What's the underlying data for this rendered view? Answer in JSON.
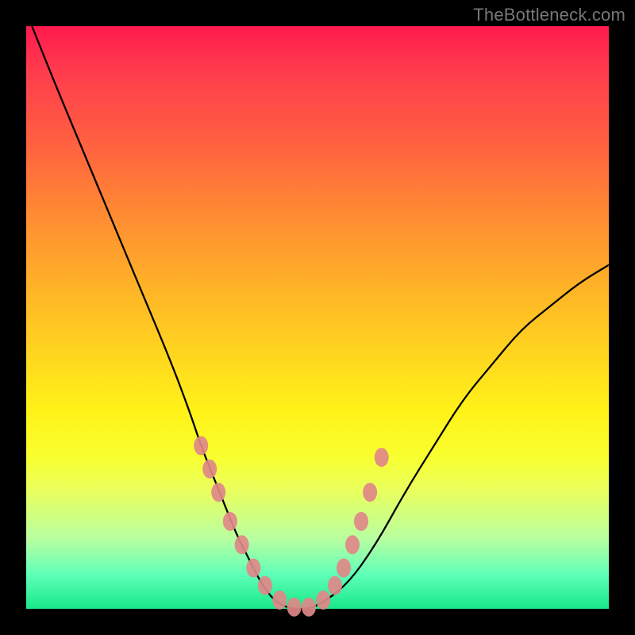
{
  "watermark": "TheBottleneck.com",
  "colors": {
    "background": "#000000",
    "gradient_top": "#ff1a4d",
    "gradient_bottom": "#18e88a",
    "curve": "#000000",
    "marker": "#e08888"
  },
  "chart_data": {
    "type": "line",
    "title": "",
    "xlabel": "",
    "ylabel": "",
    "xlim": [
      0,
      100
    ],
    "ylim": [
      0,
      100
    ],
    "series": [
      {
        "name": "curve",
        "x": [
          1,
          5,
          10,
          15,
          20,
          25,
          28,
          30,
          32,
          34,
          36,
          38,
          40,
          42,
          44,
          46,
          48,
          50,
          55,
          60,
          65,
          70,
          75,
          80,
          85,
          90,
          95,
          100
        ],
        "y": [
          100,
          90,
          78,
          66,
          54,
          42,
          34,
          28,
          23,
          18,
          13,
          9,
          5,
          2,
          0.5,
          0,
          0,
          0.5,
          4,
          11,
          20,
          28,
          36,
          42,
          48,
          52,
          56,
          59
        ]
      }
    ],
    "markers": {
      "name": "highlighted-points",
      "x": [
        30,
        31.5,
        33,
        35,
        37,
        39,
        41,
        43.5,
        46,
        48.5,
        51,
        53,
        54.5,
        56,
        57.5,
        59,
        61
      ],
      "y": [
        28,
        24,
        20,
        15,
        11,
        7,
        4,
        1.5,
        0.3,
        0.3,
        1.5,
        4,
        7,
        11,
        15,
        20,
        26
      ]
    }
  }
}
